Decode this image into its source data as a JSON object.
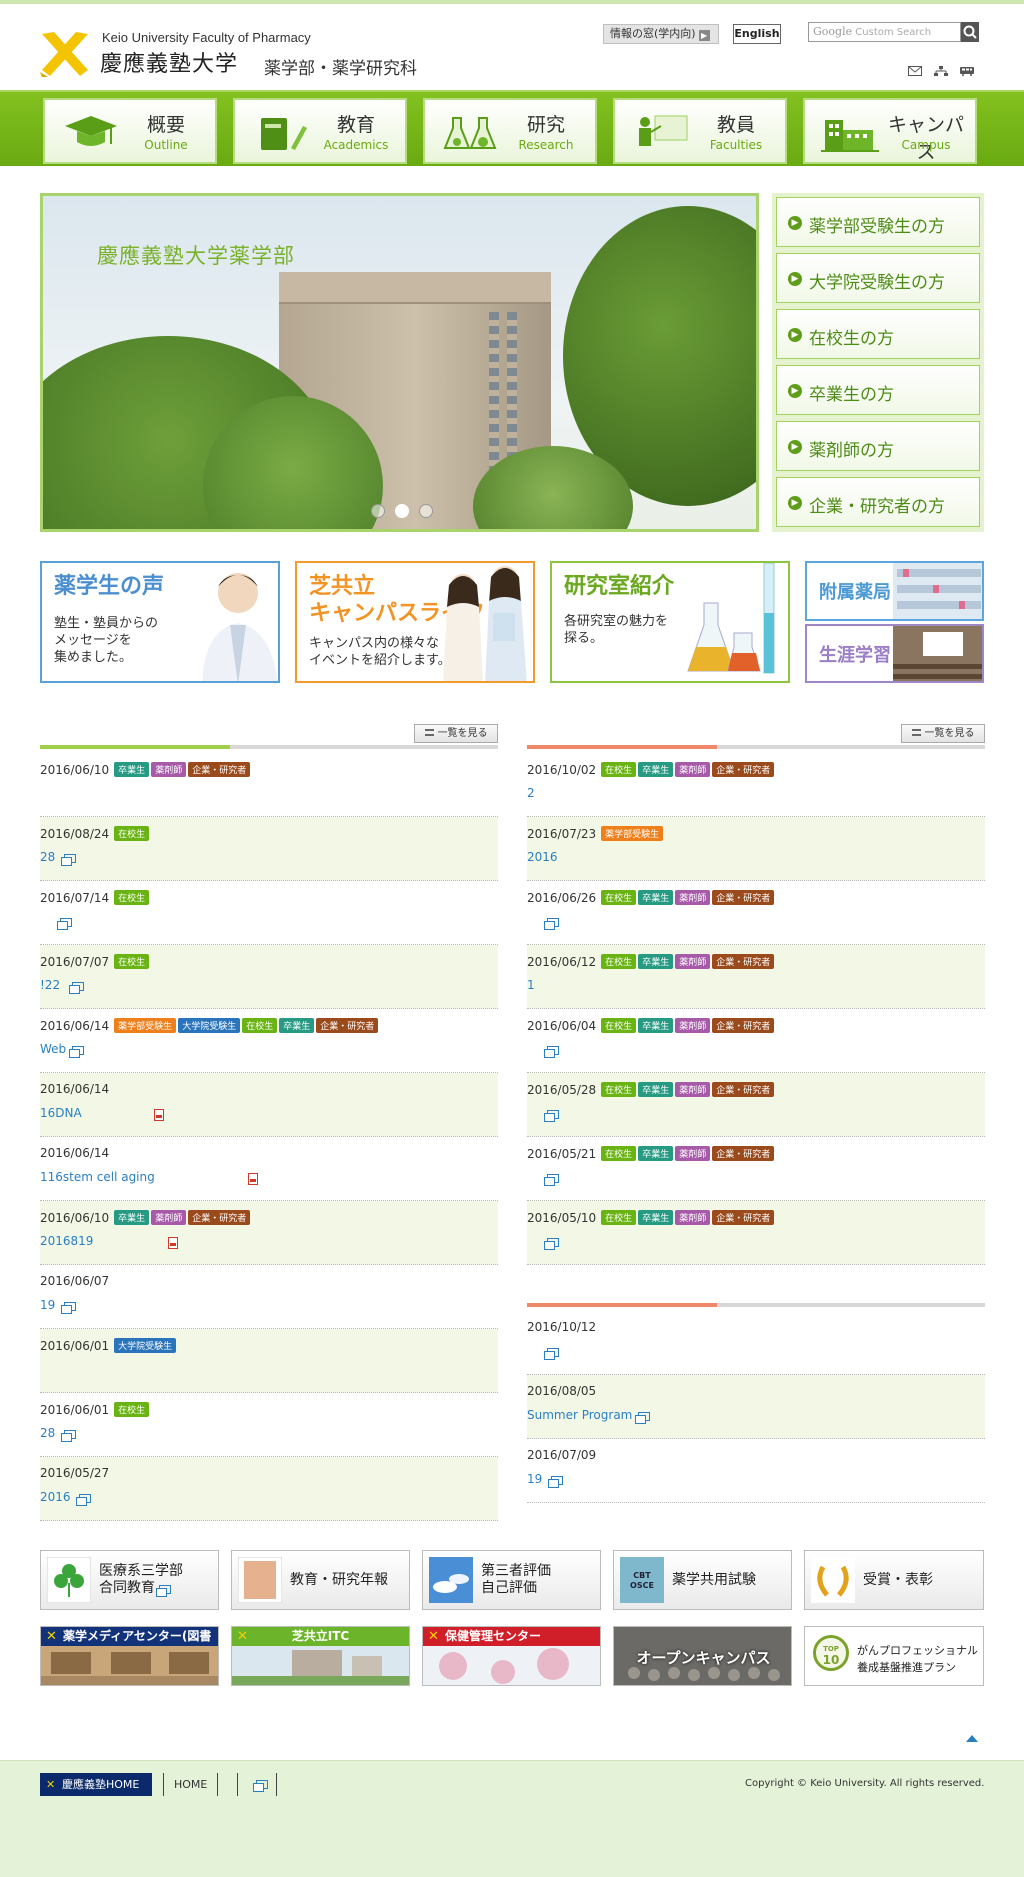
{
  "header": {
    "univ_en": "Keio University Faculty of Pharmacy",
    "univ_jp": "慶應義塾大学",
    "faculty": "薬学部・薬学研究科",
    "info_button": "情報の窓(学内向)",
    "english_button": "English",
    "search_placeholder": "Custom Search",
    "search_brand": "Google"
  },
  "nav": [
    {
      "jp": "概要",
      "en": "Outline"
    },
    {
      "jp": "教育",
      "en": "Academics"
    },
    {
      "jp": "研究",
      "en": "Research"
    },
    {
      "jp": "教員",
      "en": "Faculties"
    },
    {
      "jp": "キャンパス",
      "en": "Campus"
    }
  ],
  "hero": {
    "title": "慶應義塾大学薬学部",
    "slides": 3,
    "active_slide": 2
  },
  "side_links": [
    "薬学部受験生の方",
    "大学院受験生の方",
    "在校生の方",
    "卒業生の方",
    "薬剤師の方",
    "企業・研究者の方"
  ],
  "banners": {
    "voices": {
      "title": "薬学生の声",
      "desc1": "塾生・塾員からの",
      "desc2": "メッセージを",
      "desc3": "集めました。"
    },
    "campus": {
      "title1": "芝共立",
      "title2": "キャンパスライフ",
      "desc1": "キャンパス内の様々な",
      "desc2": "イベントを紹介します。"
    },
    "labs": {
      "title": "研究室紹介",
      "desc1": "各研究室の魅力を",
      "desc2": "探る。"
    },
    "pharmacy": {
      "title": "附属薬局"
    },
    "lifelong": {
      "title": "生涯学習"
    }
  },
  "list_button": "一覧を見る",
  "left_news": [
    {
      "date": "2016/06/10",
      "tags": [
        "卒業生",
        "薬剤師",
        "企業・研究者"
      ],
      "title": "",
      "icon": "",
      "tint": false
    },
    {
      "date": "2016/08/24",
      "tags": [
        "在校生"
      ],
      "title": "28",
      "icon": "ext",
      "tint": true
    },
    {
      "date": "2016/07/14",
      "tags": [
        "在校生"
      ],
      "title": "",
      "icon": "ext",
      "tint": false
    },
    {
      "date": "2016/07/07",
      "tags": [
        "在校生"
      ],
      "title": "!22",
      "icon": "ext",
      "tint": true
    },
    {
      "date": "2016/06/14",
      "tags": [
        "薬学部受験生",
        "大学院受験生",
        "在校生",
        "卒業生",
        "企業・研究者"
      ],
      "title": "Web",
      "icon": "ext",
      "tint": false
    },
    {
      "date": "2016/06/14",
      "tags": [],
      "title": "16DNA",
      "icon": "pdf",
      "tint": true
    },
    {
      "date": "2016/06/14",
      "tags": [],
      "title": "116stem cell aging",
      "icon": "pdf",
      "tint": false
    },
    {
      "date": "2016/06/10",
      "tags": [
        "卒業生",
        "薬剤師",
        "企業・研究者"
      ],
      "title": "2016819",
      "icon": "pdf",
      "tint": true
    },
    {
      "date": "2016/06/07",
      "tags": [],
      "title": "19",
      "icon": "ext",
      "tint": false
    },
    {
      "date": "2016/06/01",
      "tags": [
        "大学院受験生"
      ],
      "title": "",
      "icon": "",
      "tint": true
    },
    {
      "date": "2016/06/01",
      "tags": [
        "在校生"
      ],
      "title": "28",
      "icon": "ext",
      "tint": false
    },
    {
      "date": "2016/05/27",
      "tags": [],
      "title": "2016",
      "icon": "ext",
      "tint": true
    }
  ],
  "right_news": [
    {
      "date": "2016/10/02",
      "tags": [
        "在校生",
        "卒業生",
        "薬剤師",
        "企業・研究者"
      ],
      "title": "2",
      "icon": "",
      "tint": false
    },
    {
      "date": "2016/07/23",
      "tags": [
        "薬学部受験生"
      ],
      "title": "2016",
      "icon": "",
      "tint": true
    },
    {
      "date": "2016/06/26",
      "tags": [
        "在校生",
        "卒業生",
        "薬剤師",
        "企業・研究者"
      ],
      "title": "",
      "icon": "ext",
      "tint": false
    },
    {
      "date": "2016/06/12",
      "tags": [
        "在校生",
        "卒業生",
        "薬剤師",
        "企業・研究者"
      ],
      "title": "1",
      "icon": "",
      "tint": true
    },
    {
      "date": "2016/06/04",
      "tags": [
        "在校生",
        "卒業生",
        "薬剤師",
        "企業・研究者"
      ],
      "title": "",
      "icon": "ext",
      "tint": false
    },
    {
      "date": "2016/05/28",
      "tags": [
        "在校生",
        "卒業生",
        "薬剤師",
        "企業・研究者"
      ],
      "title": "",
      "icon": "ext",
      "tint": true
    },
    {
      "date": "2016/05/21",
      "tags": [
        "在校生",
        "卒業生",
        "薬剤師",
        "企業・研究者"
      ],
      "title": "",
      "icon": "ext",
      "tint": false
    },
    {
      "date": "2016/05/10",
      "tags": [
        "在校生",
        "卒業生",
        "薬剤師",
        "企業・研究者"
      ],
      "title": "",
      "icon": "ext",
      "tint": true
    }
  ],
  "right_news2": [
    {
      "date": "2016/10/12",
      "tags": [],
      "title": "",
      "icon": "ext",
      "tint": false
    },
    {
      "date": "2016/08/05",
      "tags": [],
      "title": "Summer Program",
      "icon": "ext",
      "tint": true
    },
    {
      "date": "2016/07/09",
      "tags": [],
      "title": "19",
      "icon": "ext",
      "tint": false
    }
  ],
  "bottom_links": [
    {
      "l1": "医療系三学部",
      "l2": "合同教育"
    },
    {
      "l1": "教育・研究年報",
      "l2": ""
    },
    {
      "l1": "第三者評価",
      "l2": "自己評価"
    },
    {
      "l1": "薬学共用試験",
      "l2": ""
    },
    {
      "l1": "受賞・表彰",
      "l2": ""
    }
  ],
  "cbt_label": "CBT OSCE",
  "bottom_banners": [
    {
      "caption": "薬学メディアセンター(図書館)"
    },
    {
      "caption": "芝共立ITC"
    },
    {
      "caption": "保健管理センター"
    },
    {
      "caption": "オープンキャンパス"
    },
    {
      "caption": "がんプロフェッショナル",
      "caption2": "養成基盤推進プラン",
      "badge_top": "TOP",
      "badge_num": "10"
    }
  ],
  "footer": {
    "home": "慶應義塾HOME",
    "link": "HOME",
    "copyright": "Copyright © Keio University. All rights reserved."
  }
}
